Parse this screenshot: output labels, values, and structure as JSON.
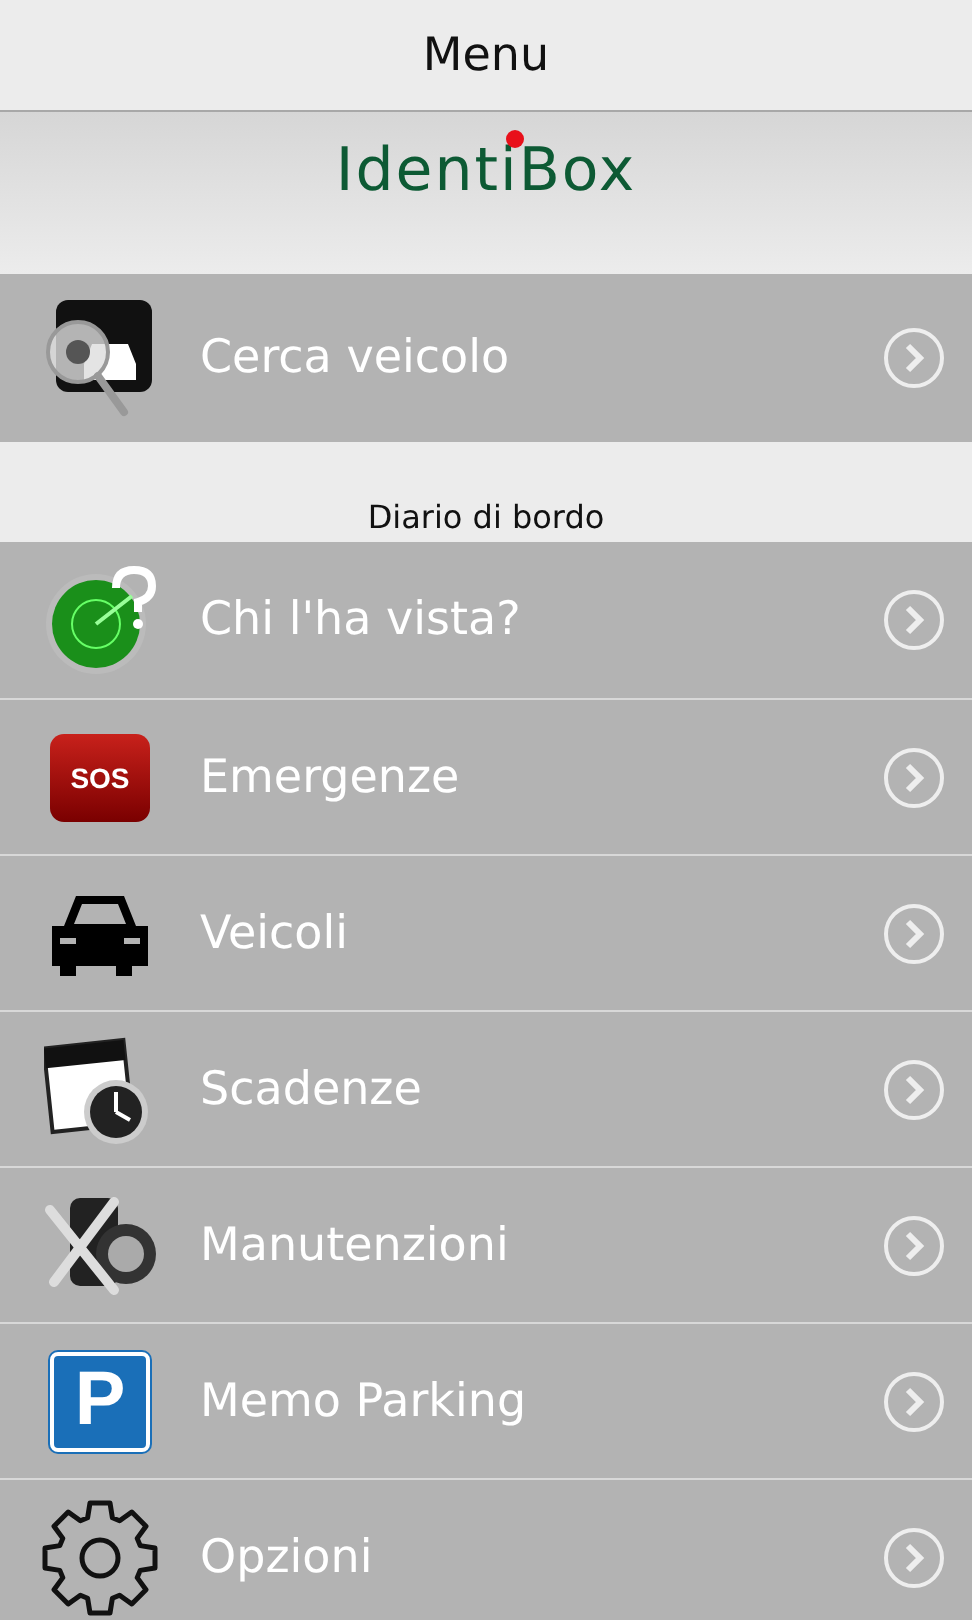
{
  "header": {
    "title": "Menu"
  },
  "logo": {
    "text": "IdentiBox"
  },
  "top_items": [
    {
      "label": "Cerca veicolo",
      "kind": "search-car"
    }
  ],
  "section": {
    "title": "Diario di bordo"
  },
  "items": [
    {
      "label": "Chi l'ha vista?",
      "kind": "radar"
    },
    {
      "label": "Emergenze",
      "kind": "sos",
      "icon_text": "SOS"
    },
    {
      "label": "Veicoli",
      "kind": "car"
    },
    {
      "label": "Scadenze",
      "kind": "calendar"
    },
    {
      "label": "Manutenzioni",
      "kind": "tools"
    },
    {
      "label": "Memo Parking",
      "kind": "parking",
      "icon_text": "P"
    },
    {
      "label": "Opzioni",
      "kind": "gear"
    }
  ]
}
